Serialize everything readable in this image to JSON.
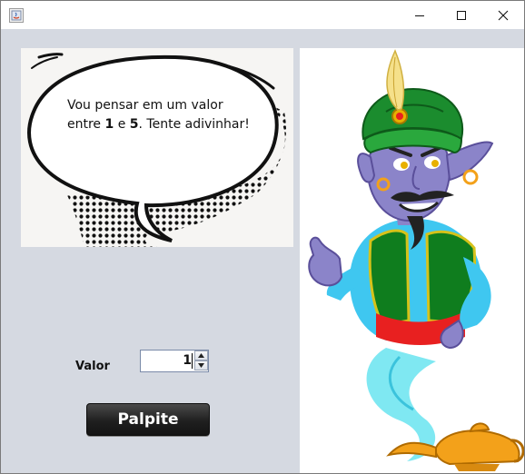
{
  "window": {
    "title": "",
    "controls": {
      "minimize_icon": "minimize-icon",
      "maximize_icon": "maximize-icon",
      "close_icon": "close-icon"
    }
  },
  "bubble": {
    "line1": "Vou pensar em um valor",
    "line2_prefix": "entre ",
    "min": "1",
    "connector": " e ",
    "max": "5",
    "line2_suffix": ". Tente adivinhar!"
  },
  "form": {
    "valor_label": "Valor",
    "spinner_value": "1",
    "guess_button_label": "Palpite"
  },
  "illustration": {
    "character": "genie",
    "object": "oil-lamp"
  },
  "colors": {
    "background": "#d5d9e1",
    "button": "#1f1f1f",
    "turban": "#1b8c2e",
    "skin": "#8b84c9",
    "shirt": "#3fc7f0",
    "vest": "#0f7d1e",
    "sash": "#e82020",
    "lamp": "#f3a11a"
  }
}
